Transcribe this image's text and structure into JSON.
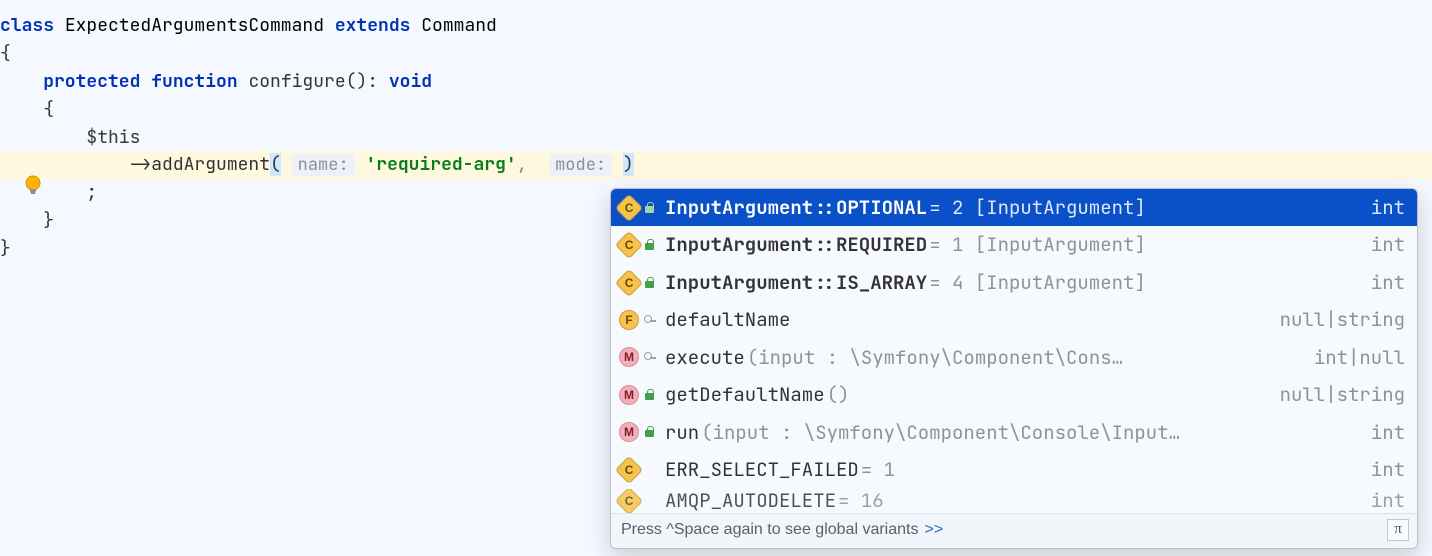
{
  "code": {
    "kw_class": "class",
    "class_name": "ExpectedArgumentsCommand",
    "kw_extends": "extends",
    "extends_name": "Command",
    "brace_open": "{",
    "kw_protected": "protected",
    "kw_function": "function",
    "method_name": "configure",
    "parens": "()",
    "colon": ":",
    "kw_void": "void",
    "method_brace_open": "{",
    "this_line": "$this",
    "arrow": "->",
    "add_argument": "addArgument",
    "open_paren": "(",
    "hint_name": "name:",
    "arg_string": "'required-arg'",
    "comma": ",",
    "hint_mode": "mode:",
    "close_paren": ")",
    "semicolon": ";",
    "method_brace_close": "}",
    "brace_close": "}"
  },
  "popup": {
    "rows": [
      {
        "kind": "c",
        "vis": "lock",
        "bold": "InputArgument::OPTIONAL",
        "post": " = 2 [InputArgument]",
        "rhs": "int",
        "selected": true
      },
      {
        "kind": "c",
        "vis": "lock",
        "bold": "InputArgument::REQUIRED",
        "post": " = 1 [InputArgument]",
        "rhs": "int"
      },
      {
        "kind": "c",
        "vis": "lock",
        "bold": "InputArgument::IS_ARRAY",
        "post": " = 4 [InputArgument]",
        "rhs": "int"
      },
      {
        "kind": "f",
        "vis": "key",
        "label": "defaultName",
        "rhs": "null|string"
      },
      {
        "kind": "m",
        "vis": "key",
        "label": "execute",
        "post": "(input : \\Symfony\\Component\\Cons…",
        "rhs": "int|null"
      },
      {
        "kind": "m",
        "vis": "lock",
        "label": "getDefaultName",
        "post": "()",
        "rhs": "null|string"
      },
      {
        "kind": "m",
        "vis": "lock",
        "label": "run",
        "post": "(input : \\Symfony\\Component\\Console\\Input…",
        "rhs": "int"
      },
      {
        "kind": "c",
        "vis": "",
        "label": "ERR_SELECT_FAILED",
        "post": " = 1",
        "rhs": "int"
      },
      {
        "kind": "c",
        "vis": "",
        "label": "AMQP_AUTODELETE",
        "post": " = 16",
        "rhs": "int",
        "partial": true
      }
    ],
    "footer_text": "Press ^Space again to see global variants",
    "footer_link": ">>",
    "pi": "π"
  }
}
